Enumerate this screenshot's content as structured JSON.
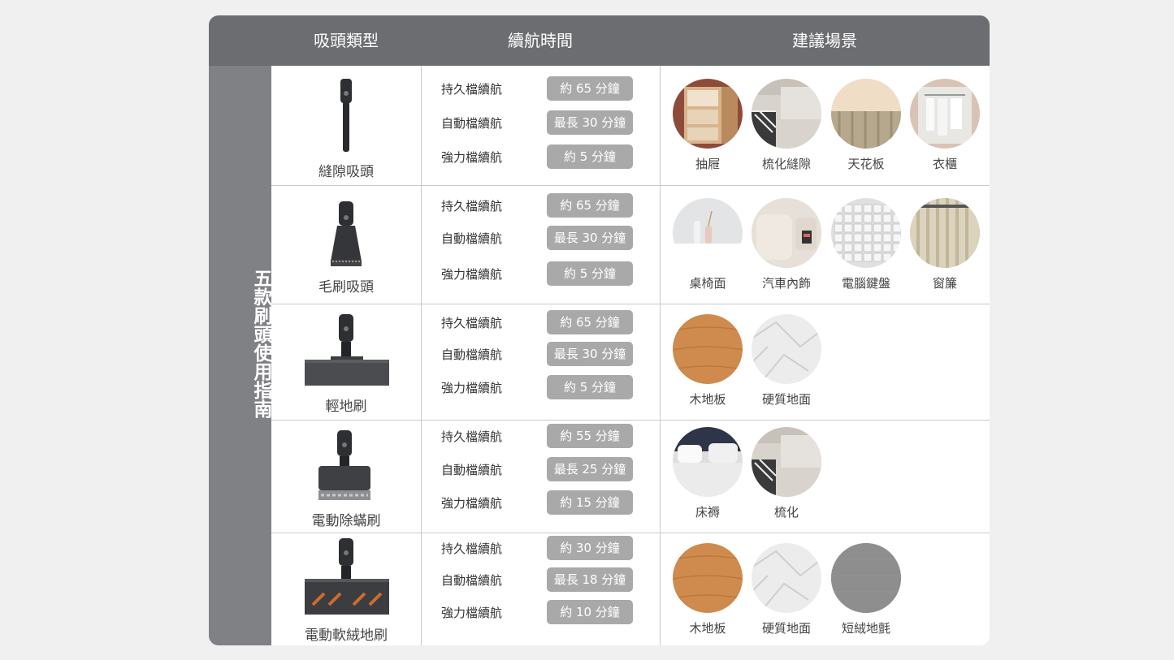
{
  "header": {
    "col1": "吸頭類型",
    "col2": "續航時間",
    "col3": "建議場景"
  },
  "side_title": "五款刷頭使用指南",
  "colors": {
    "header_bg": "#6c6d71",
    "side_bg": "#808185",
    "pill_bg": "#a9a9a9"
  },
  "rows": [
    {
      "name": "縫隙吸頭",
      "icon": "crevice-nozzle-icon",
      "modes": [
        {
          "label": "持久檔續航",
          "time": "約 65 分鐘"
        },
        {
          "label": "自動檔續航",
          "time": "最長 30 分鐘"
        },
        {
          "label": "強力檔續航",
          "time": "約 5 分鐘"
        }
      ],
      "scenes": [
        {
          "label": "抽屜",
          "icon": "drawer-photo"
        },
        {
          "label": "梳化縫隙",
          "icon": "sofa-gap-photo"
        },
        {
          "label": "天花板",
          "icon": "ceiling-photo"
        },
        {
          "label": "衣櫃",
          "icon": "wardrobe-photo"
        }
      ]
    },
    {
      "name": "毛刷吸頭",
      "icon": "brush-nozzle-icon",
      "modes": [
        {
          "label": "持久檔續航",
          "time": "約 65 分鐘"
        },
        {
          "label": "自動檔續航",
          "time": "最長 30 分鐘"
        },
        {
          "label": "強力檔續航",
          "time": "約 5 分鐘"
        }
      ],
      "scenes": [
        {
          "label": "桌椅面",
          "icon": "table-photo"
        },
        {
          "label": "汽車內飾",
          "icon": "car-interior-photo"
        },
        {
          "label": "電腦鍵盤",
          "icon": "keyboard-photo"
        },
        {
          "label": "窗簾",
          "icon": "curtain-photo"
        }
      ]
    },
    {
      "name": "輕地刷",
      "icon": "light-floor-brush-icon",
      "modes": [
        {
          "label": "持久檔續航",
          "time": "約 65 分鐘"
        },
        {
          "label": "自動檔續航",
          "time": "最長 30 分鐘"
        },
        {
          "label": "強力檔續航",
          "time": "約 5 分鐘"
        }
      ],
      "scenes": [
        {
          "label": "木地板",
          "icon": "wood-floor-photo"
        },
        {
          "label": "硬質地面",
          "icon": "marble-floor-photo"
        }
      ]
    },
    {
      "name": "電動除蟎刷",
      "icon": "mite-brush-icon",
      "modes": [
        {
          "label": "持久檔續航",
          "time": "約 55 分鐘"
        },
        {
          "label": "自動檔續航",
          "time": "最長 25 分鐘"
        },
        {
          "label": "強力檔續航",
          "time": "約 15 分鐘"
        }
      ],
      "scenes": [
        {
          "label": "床褥",
          "icon": "bed-photo"
        },
        {
          "label": "梳化",
          "icon": "sofa-photo"
        }
      ]
    },
    {
      "name": "電動軟絨地刷",
      "icon": "soft-roller-brush-icon",
      "modes": [
        {
          "label": "持久檔續航",
          "time": "約 30 分鐘"
        },
        {
          "label": "自動檔續航",
          "time": "最長 18 分鐘"
        },
        {
          "label": "強力檔續航",
          "time": "約 10 分鐘"
        }
      ],
      "scenes": [
        {
          "label": "木地板",
          "icon": "wood-floor-photo"
        },
        {
          "label": "硬質地面",
          "icon": "marble-floor-photo"
        },
        {
          "label": "短絨地氈",
          "icon": "carpet-photo"
        }
      ]
    }
  ]
}
